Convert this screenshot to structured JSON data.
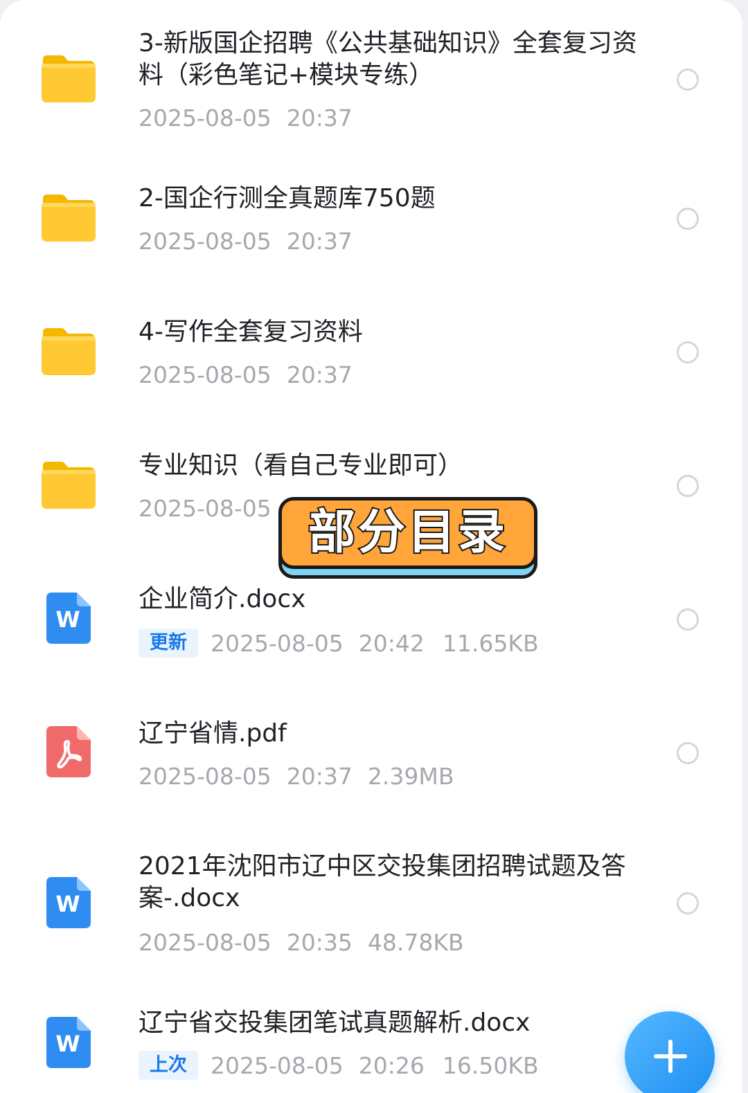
{
  "colors": {
    "folder": "#ffc933",
    "word": "#2f8cf0",
    "pdf": "#f06a6a",
    "accent": "#1b78e8",
    "badge_fill": "#ffa53a",
    "badge_shadow": "#7fd3f3"
  },
  "overlay": {
    "badge_text": "部分目录"
  },
  "files": [
    {
      "name": "3-新版国企招聘《公共基础知识》全套复习资料（彩色笔记+模块专练）",
      "icon": "folder-icon",
      "date": "2025-08-05",
      "time": "20:37",
      "size": "",
      "tag": ""
    },
    {
      "name": "2-国企行测全真题库750题",
      "icon": "folder-icon",
      "date": "2025-08-05",
      "time": "20:37",
      "size": "",
      "tag": ""
    },
    {
      "name": "4-写作全套复习资料",
      "icon": "folder-icon",
      "date": "2025-08-05",
      "time": "20:37",
      "size": "",
      "tag": ""
    },
    {
      "name": "专业知识（看自己专业即可）",
      "icon": "folder-icon",
      "date": "2025-08-05",
      "time": "",
      "size": "",
      "tag": ""
    },
    {
      "name": "企业简介.docx",
      "icon": "word-doc-icon",
      "date": "2025-08-05",
      "time": "20:42",
      "size": "11.65KB",
      "tag": "更新"
    },
    {
      "name": "辽宁省情.pdf",
      "icon": "pdf-doc-icon",
      "date": "2025-08-05",
      "time": "20:37",
      "size": "2.39MB",
      "tag": ""
    },
    {
      "name": "2021年沈阳市辽中区交投集团招聘试题及答案-.docx",
      "icon": "word-doc-icon",
      "date": "2025-08-05",
      "time": "20:35",
      "size": "48.78KB",
      "tag": ""
    },
    {
      "name": "辽宁省交投集团笔试真题解析.docx",
      "icon": "word-doc-icon",
      "date": "2025-08-05",
      "time": "20:26",
      "size": "16.50KB",
      "tag": "上次"
    }
  ]
}
